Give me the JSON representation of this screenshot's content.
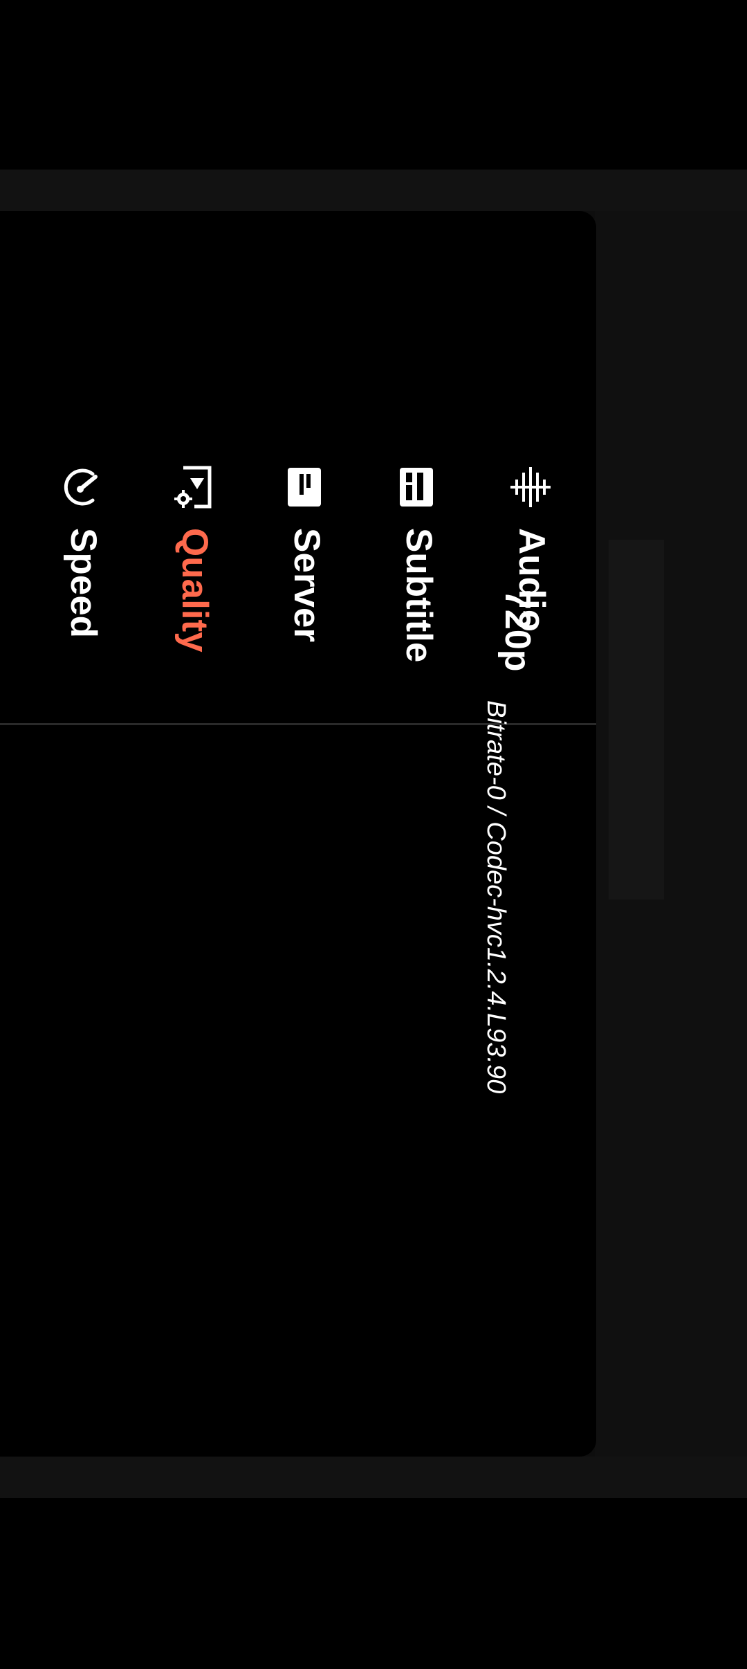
{
  "tabs": [
    {
      "label": "Audio",
      "icon": "audio-tracks-icon",
      "active": false
    },
    {
      "label": "Subtitle",
      "icon": "subtitle-icon",
      "active": false
    },
    {
      "label": "Server",
      "icon": "server-icon",
      "active": false
    },
    {
      "label": "Quality",
      "icon": "quality-settings-icon",
      "active": true
    },
    {
      "label": "Speed",
      "icon": "speed-gauge-icon",
      "active": false
    }
  ],
  "quality": {
    "options": [
      {
        "title": "720p",
        "detail": "Bitrate-0 / Codec-hvc1.2.4.L93.90"
      }
    ]
  },
  "colors": {
    "background": "#000000",
    "text": "#ffffff",
    "accent": "#ff6a4d",
    "divider": "#2a2a2a"
  }
}
